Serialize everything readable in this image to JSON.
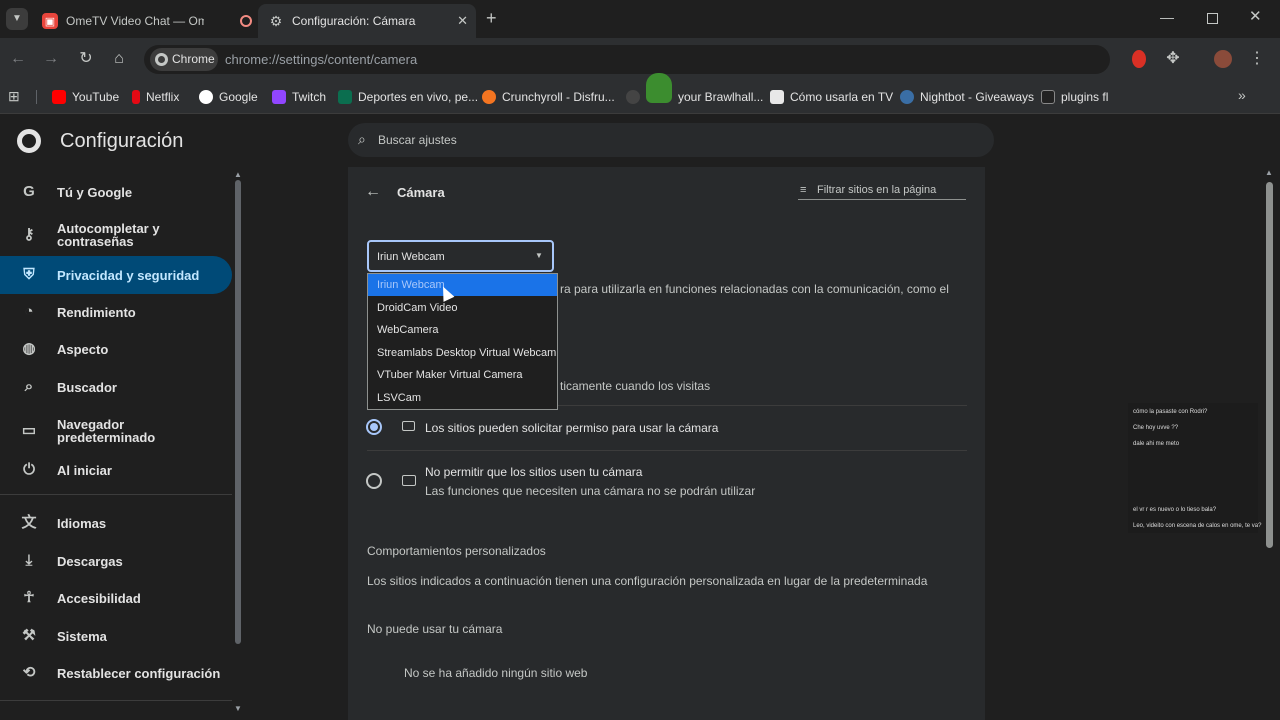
{
  "tabs": [
    {
      "title": "OmeTV Video Chat — Ome",
      "active": false
    },
    {
      "title": "Configuración: Cámara",
      "active": true
    }
  ],
  "toolbar": {
    "chip_label": "Chrome",
    "url": "chrome://settings/content/camera"
  },
  "bookmarks": [
    {
      "label": "YouTube",
      "color": "#ff0000"
    },
    {
      "label": "Netflix",
      "color": "#e50914"
    },
    {
      "label": "Google",
      "color": "#4285f4"
    },
    {
      "label": "Twitch",
      "color": "#9146ff"
    },
    {
      "label": "Deportes en vivo, pe...",
      "color": "#0b6e4f"
    },
    {
      "label": "Crunchyroll - Disfru...",
      "color": "#f47521"
    },
    {
      "label": "your Brawlhall...",
      "color": "#444444"
    },
    {
      "label": "Cómo usarla en TV",
      "color": "#e8e8e8"
    },
    {
      "label": "Nightbot - Giveaways",
      "color": "#3a6ea5"
    },
    {
      "label": "plugins fl",
      "color": "#222222"
    }
  ],
  "settings": {
    "title": "Configuración",
    "search_placeholder": "Buscar ajustes",
    "nav": [
      {
        "label": "Tú y Google",
        "icon": "google-icon"
      },
      {
        "label": "Autocompletar y contraseñas",
        "icon": "key-icon"
      },
      {
        "label": "Privacidad y seguridad",
        "icon": "shield-icon",
        "active": true
      },
      {
        "label": "Rendimiento",
        "icon": "speedometer-icon"
      },
      {
        "label": "Aspecto",
        "icon": "palette-icon"
      },
      {
        "label": "Buscador",
        "icon": "search-icon"
      },
      {
        "label": "Navegador predeterminado",
        "icon": "browser-icon"
      },
      {
        "label": "Al iniciar",
        "icon": "power-icon"
      },
      {
        "label": "Idiomas",
        "icon": "translate-icon"
      },
      {
        "label": "Descargas",
        "icon": "download-icon"
      },
      {
        "label": "Accesibilidad",
        "icon": "accessibility-icon"
      },
      {
        "label": "Sistema",
        "icon": "wrench-icon"
      },
      {
        "label": "Restablecer configuración",
        "icon": "reset-icon"
      }
    ]
  },
  "camera": {
    "heading": "Cámara",
    "filter_placeholder": "Filtrar sitios en la página",
    "selected_device": "Iriun Webcam",
    "devices": [
      "Iriun Webcam",
      "DroidCam Video",
      "WebCamera",
      "Streamlabs Desktop Virtual Webcam",
      "VTuber Maker Virtual Camera",
      "LSVCam"
    ],
    "hidden_text_1": "ra para utilizarla en funciones relacionadas con la comunicación, como el",
    "hidden_text_2": "ticamente cuando los visitas",
    "option_allow": "Los sitios pueden solicitar permiso para usar la cámara",
    "option_block": "No permitir que los sitios usen tu cámara",
    "option_block_desc": "Las funciones que necesiten una cámara no se podrán utilizar",
    "custom_heading": "Comportamientos personalizados",
    "custom_desc": "Los sitios indicados a continuación tienen una configuración personalizada en lugar de la predeterminada",
    "blocked_heading": "No puede usar tu cámara",
    "no_sites": "No se ha añadido ningún sitio web"
  },
  "chat_overlay": {
    "messages": [
      "cómo la pasaste con Rodri?",
      "Che hoy uvve ??",
      "dale ahi me meto",
      "el vr r es nuevo o lo tieso bala?",
      "Leo, videito con escena de calos en ome, te va?"
    ]
  }
}
